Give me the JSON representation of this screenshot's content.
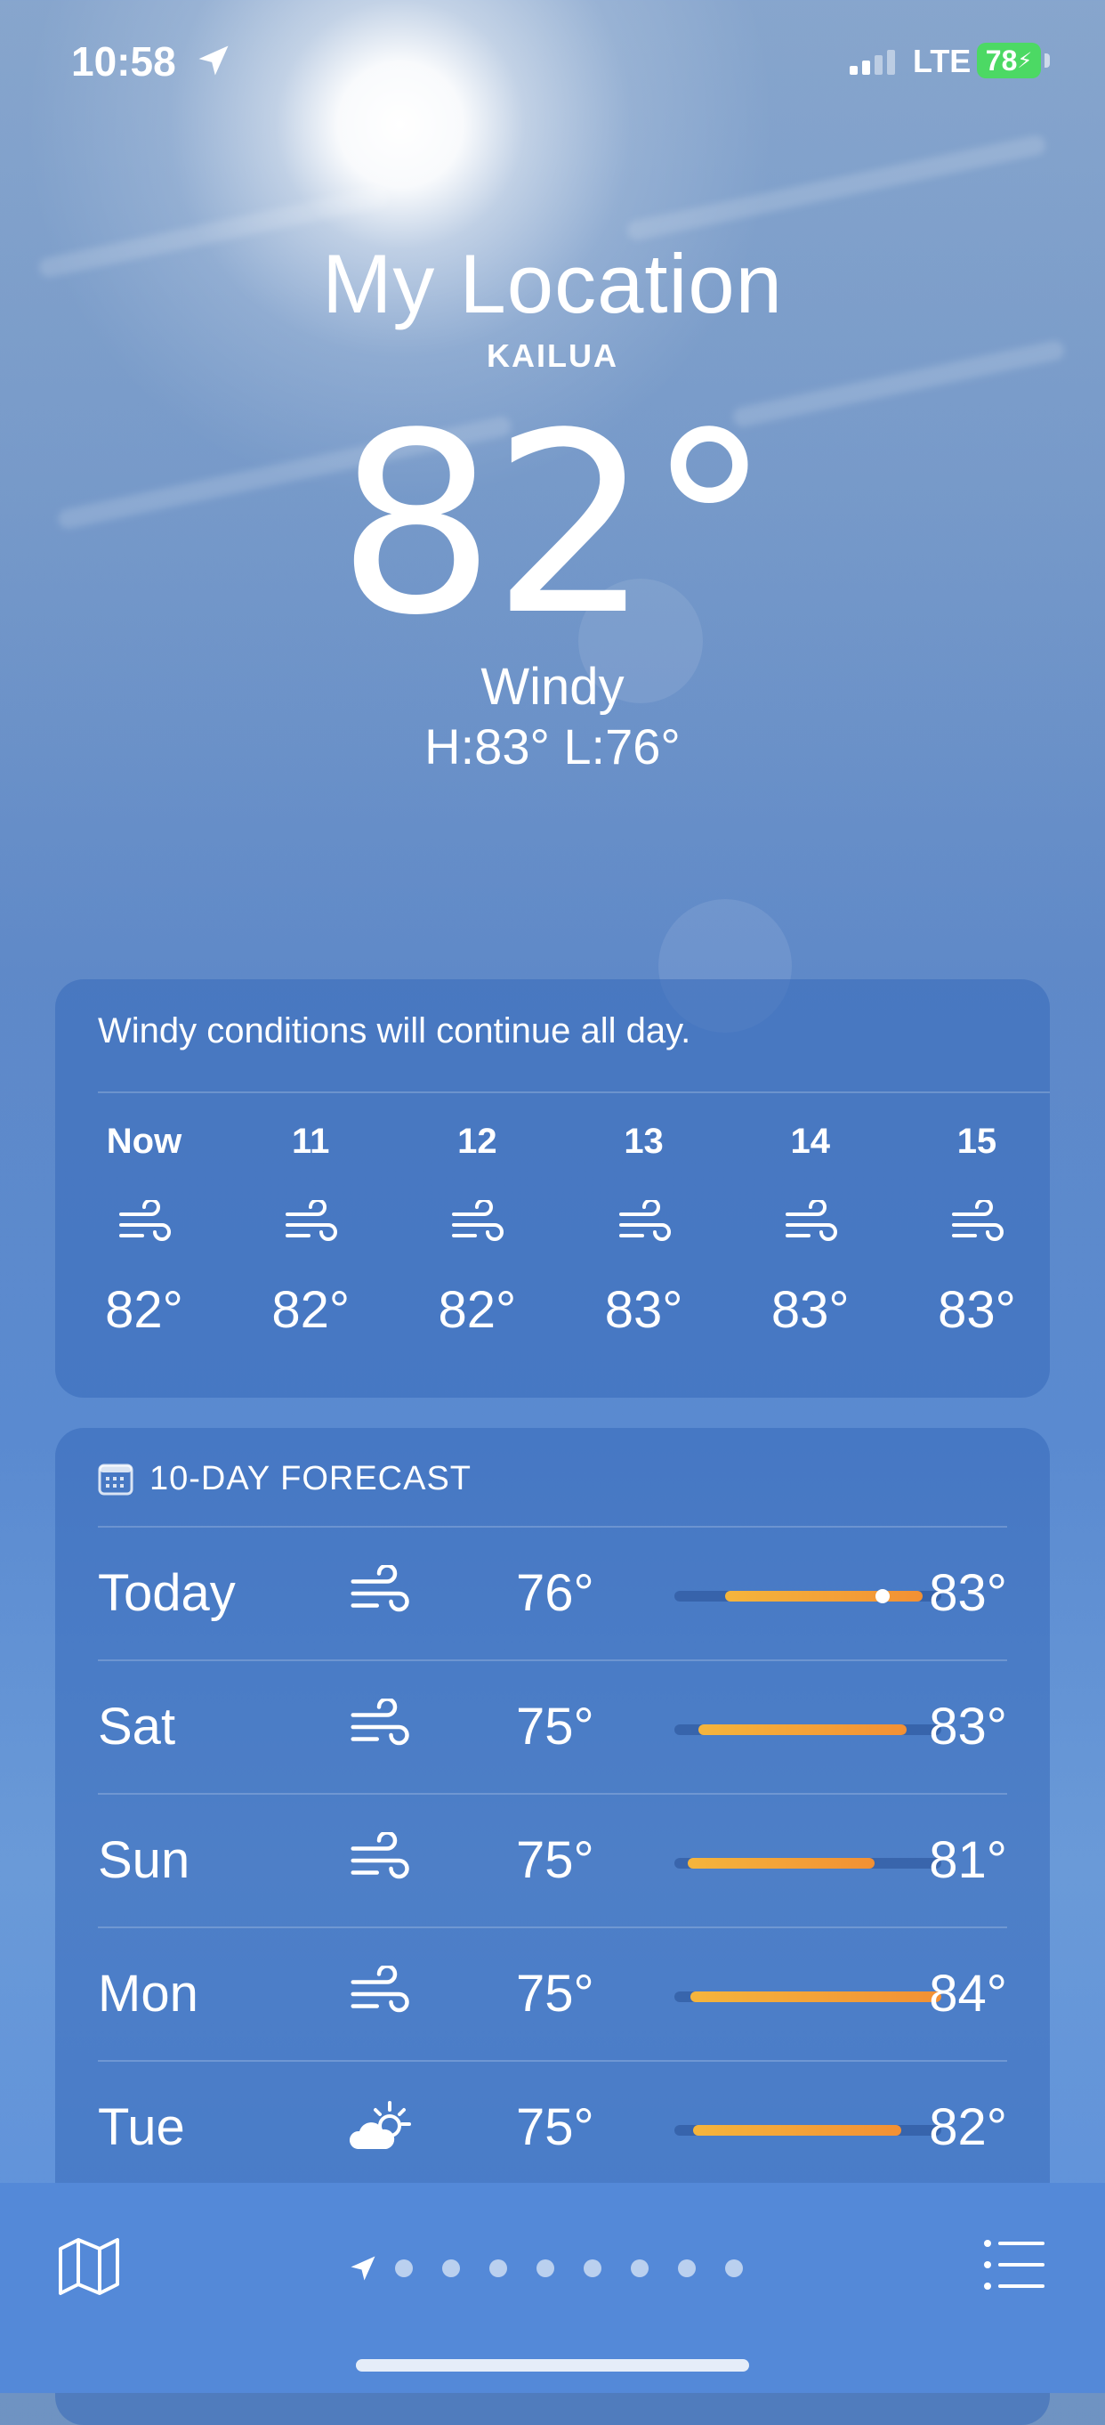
{
  "status_bar": {
    "time": "10:58",
    "network": "LTE",
    "battery": "78"
  },
  "header": {
    "location": "My Location",
    "sublocation": "KAILUA",
    "temperature": "82°",
    "condition": "Windy",
    "high_low": "H:83°  L:76°"
  },
  "hourly": {
    "summary": "Windy conditions will continue all day.",
    "items": [
      {
        "label": "Now",
        "icon": "wind-icon",
        "temp": "82°"
      },
      {
        "label": "11",
        "icon": "wind-icon",
        "temp": "82°"
      },
      {
        "label": "12",
        "icon": "wind-icon",
        "temp": "82°"
      },
      {
        "label": "13",
        "icon": "wind-icon",
        "temp": "83°"
      },
      {
        "label": "14",
        "icon": "wind-icon",
        "temp": "83°"
      },
      {
        "label": "15",
        "icon": "wind-icon",
        "temp": "83°"
      }
    ]
  },
  "forecast": {
    "title": "10-DAY FORECAST",
    "days": [
      {
        "day": "Today",
        "icon": "wind-icon",
        "low": "76°",
        "high": "83°",
        "range_start": 0.19,
        "range_end": 0.93,
        "current": 0.78
      },
      {
        "day": "Sat",
        "icon": "wind-icon",
        "low": "75°",
        "high": "83°",
        "range_start": 0.09,
        "range_end": 0.87
      },
      {
        "day": "Sun",
        "icon": "wind-icon",
        "low": "75°",
        "high": "81°",
        "range_start": 0.05,
        "range_end": 0.75
      },
      {
        "day": "Mon",
        "icon": "wind-icon",
        "low": "75°",
        "high": "84°",
        "range_start": 0.06,
        "range_end": 1.0
      },
      {
        "day": "Tue",
        "icon": "partly-cloudy-icon",
        "low": "75°",
        "high": "82°",
        "range_start": 0.07,
        "range_end": 0.85
      }
    ]
  },
  "colors": {
    "range_start": "#f5b53c",
    "range_end": "#f29034",
    "battery": "#4cd964"
  },
  "bottom_bar": {
    "page_count": 8,
    "active_page": "current-location"
  }
}
